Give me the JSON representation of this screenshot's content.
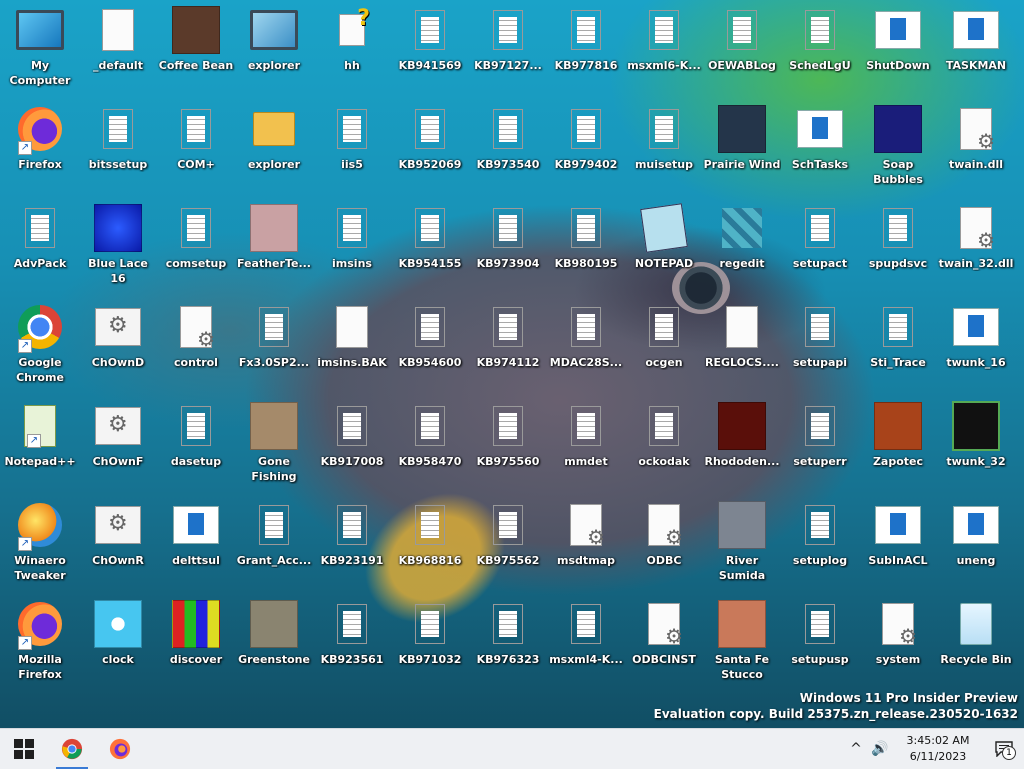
{
  "desktop": {
    "columns": [
      [
        "My Computer",
        "Firefox",
        "AdvPack",
        "Google Chrome",
        "Notepad++",
        "Winaero Tweaker",
        "Mozilla Firefox"
      ],
      [
        "_default",
        "bitssetup",
        "Blue Lace 16",
        "ChOwnD",
        "ChOwnF",
        "ChOwnR",
        "clock"
      ],
      [
        "Coffee Bean",
        "COM+",
        "comsetup",
        "control",
        "dasetup",
        "delttsul",
        "discover"
      ],
      [
        "explorer",
        "explorer",
        "FeatherTe...",
        "Fx3.0SP2...",
        "Gone Fishing",
        "Grant_Acc...",
        "Greenstone"
      ],
      [
        "hh",
        "iis5",
        "imsins",
        "imsins.BAK",
        "KB917008",
        "KB923191",
        "KB923561"
      ],
      [
        "KB941569",
        "KB952069",
        "KB954155",
        "KB954600",
        "KB958470",
        "KB968816",
        "KB971032"
      ],
      [
        "KB97127...",
        "KB973540",
        "KB973904",
        "KB974112",
        "KB975560",
        "KB975562",
        "KB976323"
      ],
      [
        "KB977816",
        "KB979402",
        "KB980195",
        "MDAC28S...",
        "mmdet",
        "msdtmap",
        "msxml4-K..."
      ],
      [
        "msxml6-K...",
        "muisetup",
        "NOTEPAD",
        "ocgen",
        "ockodak",
        "ODBC",
        "ODBCINST"
      ],
      [
        "OEWABLog",
        "Prairie Wind",
        "regedit",
        "REGLOCS....",
        "Rhododen...",
        "River Sumida",
        "Santa Fe Stucco"
      ],
      [
        "SchedLgU",
        "SchTasks",
        "setupact",
        "setupapi",
        "setuperr",
        "setuplog",
        "setupusp"
      ],
      [
        "ShutDown",
        "Soap Bubbles",
        "spupdsvc",
        "Sti_Trace",
        "Zapotec",
        "SubInACL",
        "system"
      ],
      [
        "TASKMAN",
        "twain.dll",
        "twain_32.dll",
        "twunk_16",
        "twunk_32",
        "uneng",
        "Recycle Bin"
      ]
    ],
    "icon_types": [
      [
        "monitor",
        "firefox",
        "doc",
        "chrome",
        "npp",
        "winaero",
        "firefox"
      ],
      [
        "blank",
        "doc",
        "bluelace",
        "gearwin",
        "gearwin",
        "gearwin",
        "clock"
      ],
      [
        "coffee",
        "doc",
        "doc",
        "gear",
        "doc",
        "window",
        "discover"
      ],
      [
        "computer",
        "folder",
        "feather",
        "doc",
        "gone",
        "doc",
        "greenstone"
      ],
      [
        "help",
        "doc",
        "doc",
        "blank",
        "doc",
        "doc",
        "doc"
      ],
      [
        "doc",
        "doc",
        "doc",
        "doc",
        "doc",
        "doc",
        "doc"
      ],
      [
        "doc",
        "doc",
        "doc",
        "doc",
        "doc",
        "doc",
        "doc"
      ],
      [
        "doc",
        "doc",
        "doc",
        "doc",
        "doc",
        "gear",
        "doc"
      ],
      [
        "doc",
        "doc",
        "notepad",
        "doc",
        "doc",
        "gear",
        "gear"
      ],
      [
        "doc",
        "prairie",
        "regedit",
        "blank",
        "rhodo",
        "river",
        "santafe"
      ],
      [
        "doc",
        "window",
        "doc",
        "doc",
        "doc",
        "doc",
        "doc"
      ],
      [
        "window",
        "soap",
        "doc",
        "doc",
        "zapotec",
        "window",
        "gear"
      ],
      [
        "window",
        "gear",
        "gear",
        "window",
        "twunk32",
        "uneng",
        "recycle"
      ]
    ],
    "watermark_line1": "Windows 11 Pro Insider Preview",
    "watermark_line2": "Evaluation copy. Build 25375.zn_release.230520-1632"
  },
  "taskbar": {
    "start_icon": "windows-start-icon",
    "pinned": [
      "chrome-icon",
      "firefox-icon"
    ],
    "tray_chevron": "^",
    "volume_icon": "speaker-icon",
    "time": "3:45:02 AM",
    "date": "6/11/2023",
    "notification_count": "1"
  },
  "colors": {
    "taskbar_bg": "#eef0f3",
    "accent": "#3a7bd5"
  }
}
